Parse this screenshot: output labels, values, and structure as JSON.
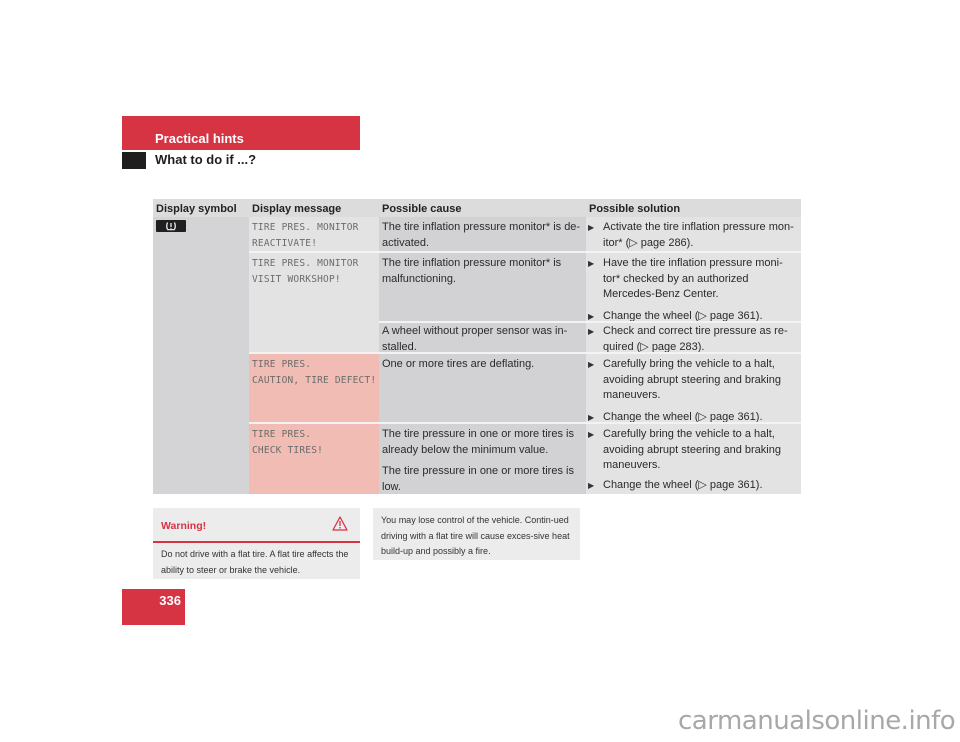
{
  "header": {
    "section": "Practical hints",
    "subsection": "What to do if ...?"
  },
  "table": {
    "columns": [
      "Display symbol",
      "Display message",
      "Possible cause",
      "Possible solution"
    ],
    "symbol_icon": "tire-pressure-warning-icon",
    "rows": [
      {
        "message": [
          "TIRE PRES. MONITOR",
          "REACTIVATE!"
        ],
        "causes": [
          {
            "text": "The tire inflation pressure monitor* is de-activated.",
            "solutions": [
              "Activate the tire inflation pressure mon-itor* (▷ page 286)."
            ]
          }
        ]
      },
      {
        "message": [
          "TIRE PRES. MONITOR",
          "VISIT WORKSHOP!"
        ],
        "causes": [
          {
            "text": "The tire inflation pressure monitor* is malfunctioning.",
            "solutions": [
              "Have the tire inflation pressure moni-tor* checked by an authorized Mercedes-Benz Center.",
              "Change the wheel (▷ page 361)."
            ]
          },
          {
            "text": "A wheel without proper sensor was in-stalled.",
            "solutions": [
              "Check and correct tire pressure as re-quired (▷ page 283)."
            ]
          }
        ]
      },
      {
        "message": [
          "TIRE PRES.",
          "CAUTION, TIRE DEFECT!"
        ],
        "highlight": "#f1bcb3",
        "causes": [
          {
            "text": "One or more tires are deflating.",
            "solutions": [
              "Carefully bring the vehicle to a halt, avoiding abrupt steering and braking maneuvers.",
              "Change the wheel (▷ page 361)."
            ]
          }
        ]
      },
      {
        "message": [
          "TIRE PRES.",
          "CHECK TIRES!"
        ],
        "highlight": "#f1bcb3",
        "causes": [
          {
            "texts": [
              "The tire pressure in one or more tires is already below the minimum value.",
              "The tire pressure in one or more tires is low."
            ],
            "solutions": [
              "Carefully bring the vehicle to a halt, avoiding abrupt steering and braking maneuvers.",
              "Change the wheel (▷ page 361)."
            ]
          }
        ]
      }
    ]
  },
  "warning": {
    "title": "Warning!",
    "icon": "warning-triangle-icon",
    "text": "Do not drive with a flat tire. A flat tire affects the ability to steer or brake the vehicle.",
    "continued": "You may lose control of the vehicle. Contin-ued driving with a flat tire will cause exces-sive heat build-up and possibly a fire."
  },
  "page_number": "336",
  "watermark": "carmanualsonline.info",
  "colors": {
    "brand_red": "#d63343",
    "highlight_red": "#f1bcb3"
  }
}
